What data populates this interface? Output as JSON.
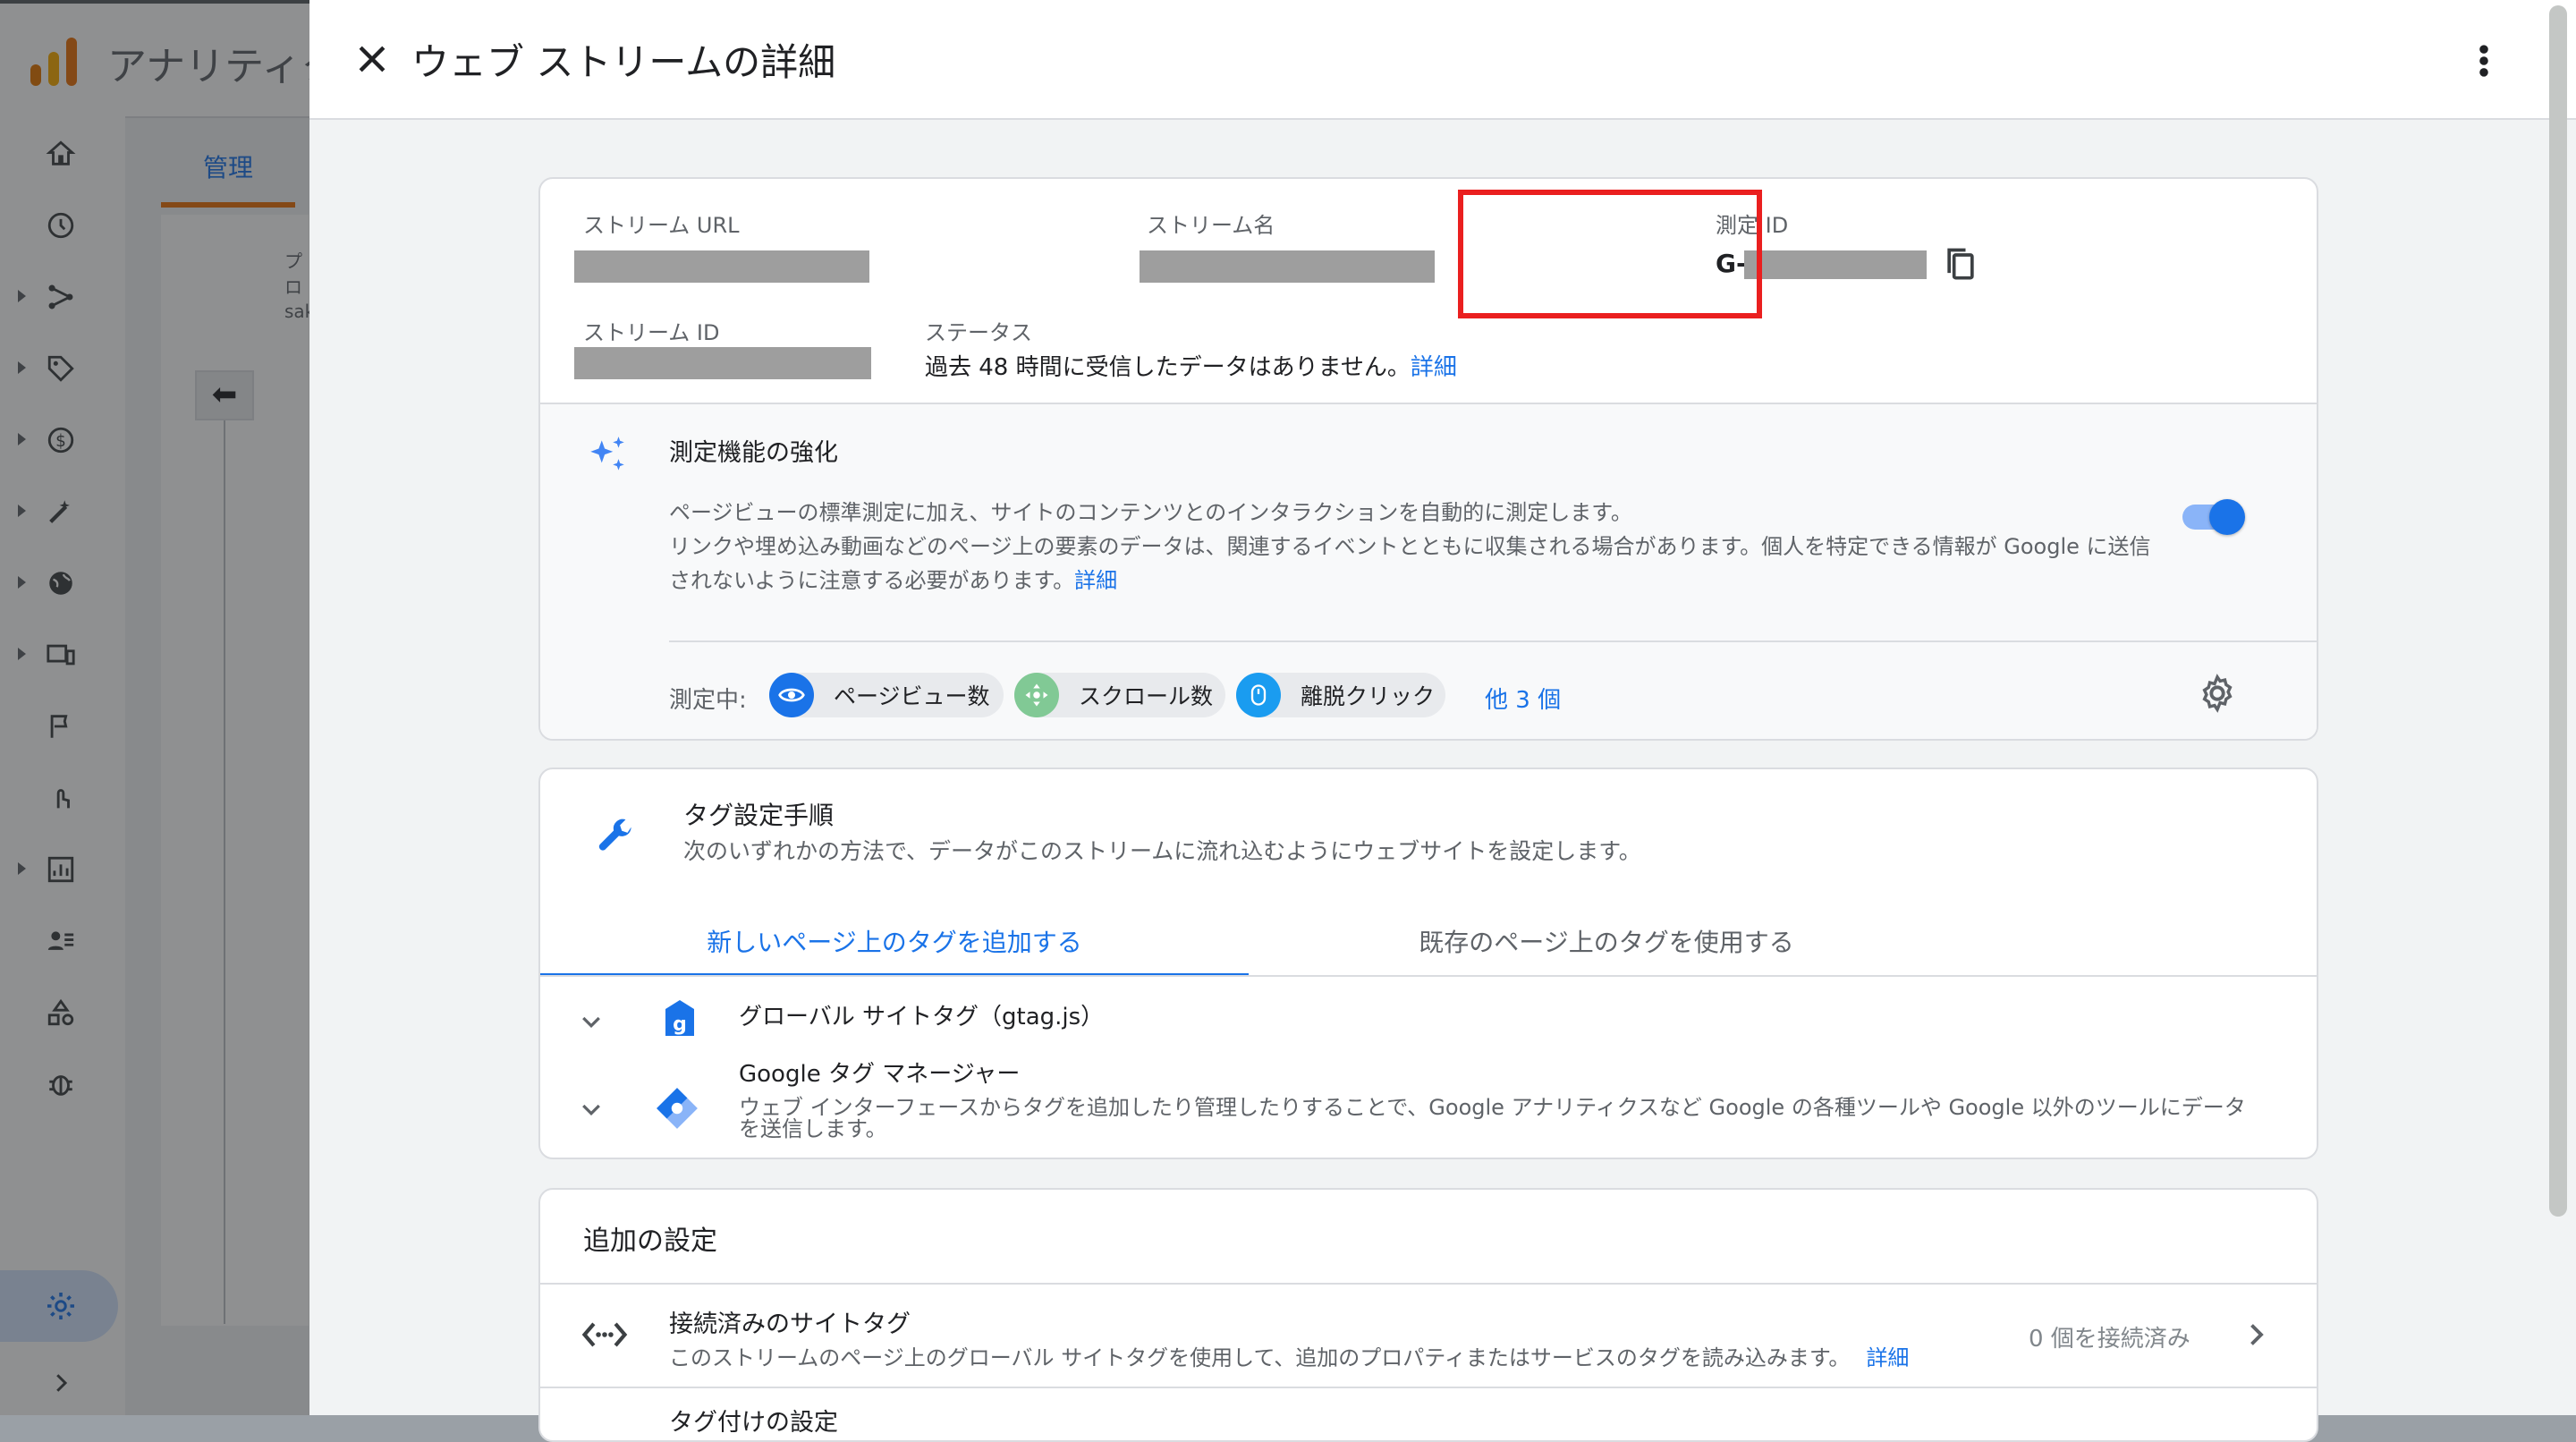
{
  "background": {
    "app_name": "アナリティクス",
    "admin_tab": "管理",
    "partial_text_1": "プロ",
    "partial_text_2": "sak"
  },
  "drawer": {
    "title": "ウェブ ストリームの詳細",
    "stream_details": {
      "url_label": "ストリーム URL",
      "name_label": "ストリーム名",
      "measurement_id_label": "測定 ID",
      "measurement_id_prefix": "G-",
      "stream_id_label": "ストリーム ID",
      "status_label": "ステータス",
      "status_text": "過去 48 時間に受信したデータはありません。",
      "status_link": "詳細"
    },
    "enhanced": {
      "title": "測定機能の強化",
      "desc_line1": "ページビューの標準測定に加え、サイトのコンテンツとのインタラクションを自動的に測定します。",
      "desc_line2": "リンクや埋め込み動画などのページ上の要素のデータは、関連するイベントとともに収集される場合があります。個人を特定できる情報が Google に送信",
      "desc_line3": "されないように注意する必要があります。",
      "desc_link": "詳細",
      "enabled": true,
      "measuring_label": "測定中:",
      "chips": [
        {
          "label": "ページビュー数",
          "icon": "eye-icon",
          "color": "#1a73e8"
        },
        {
          "label": "スクロール数",
          "icon": "scroll-icon",
          "color": "#81c995"
        },
        {
          "label": "離脱クリック",
          "icon": "mouse-icon",
          "color": "#1a9cf0"
        }
      ],
      "more_link": "他 3 個"
    },
    "tagging": {
      "title": "タグ設定手順",
      "subtitle": "次のいずれかの方法で、データがこのストリームに流れ込むようにウェブサイトを設定します。",
      "tabs": [
        "新しいページ上のタグを追加する",
        "既存のページ上のタグを使用する"
      ],
      "items": [
        {
          "title": "グローバル サイトタグ（gtag.js）",
          "desc": ""
        },
        {
          "title": "Google タグ マネージャー",
          "desc_line1": "ウェブ インターフェースからタグを追加したり管理したりすることで、Google アナリティクスなど Google の各種ツールや Google 以外のツールにデータ",
          "desc_line2": "を送信します。"
        }
      ]
    },
    "additional": {
      "title": "追加の設定",
      "connected_title": "接続済みのサイトタグ",
      "connected_desc": "このストリームのページ上のグローバル サイトタグを使用して、追加のプロパティまたはサービスのタグを読み込みます。",
      "connected_link": "詳細",
      "connected_count": "0 個を接続済み",
      "next_title": "タグ付けの設定"
    }
  },
  "colors": {
    "accent": "#1a73e8",
    "highlight": "#ea1f1f",
    "analytics_orange": "#f9ab00"
  }
}
